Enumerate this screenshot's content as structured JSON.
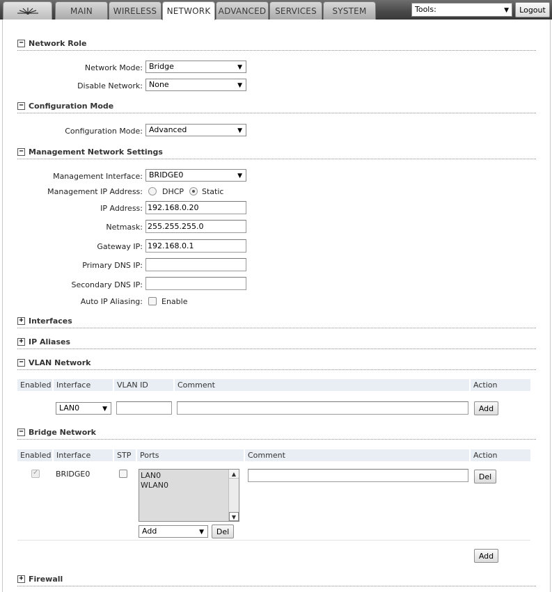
{
  "topbar": {
    "tabs": [
      {
        "label": "MAIN"
      },
      {
        "label": "WIRELESS"
      },
      {
        "label": "NETWORK"
      },
      {
        "label": "ADVANCED"
      },
      {
        "label": "SERVICES"
      },
      {
        "label": "SYSTEM"
      }
    ],
    "active_tab": "NETWORK",
    "tools_select": "Tools:",
    "logout_label": "Logout",
    "logo_icon": "ubiquiti-logo-icon"
  },
  "network_role": {
    "title": "Network Role",
    "network_mode_label": "Network Mode:",
    "network_mode_value": "Bridge",
    "disable_network_label": "Disable Network:",
    "disable_network_value": "None"
  },
  "configuration_mode": {
    "title": "Configuration Mode",
    "label": "Configuration Mode:",
    "value": "Advanced"
  },
  "management": {
    "title": "Management Network Settings",
    "interface_label": "Management Interface:",
    "interface_value": "BRIDGE0",
    "ip_address_mode_label": "Management IP Address:",
    "dhcp_label": "DHCP",
    "static_label": "Static",
    "ip_mode_selected": "Static",
    "ip_address_label": "IP Address:",
    "ip_address_value": "192.168.0.20",
    "netmask_label": "Netmask:",
    "netmask_value": "255.255.255.0",
    "gateway_label": "Gateway IP:",
    "gateway_value": "192.168.0.1",
    "primary_dns_label": "Primary DNS IP:",
    "primary_dns_value": "",
    "secondary_dns_label": "Secondary DNS IP:",
    "secondary_dns_value": "",
    "auto_ip_aliasing_label": "Auto IP Aliasing:",
    "auto_ip_aliasing_option": "Enable"
  },
  "interfaces": {
    "title": "Interfaces"
  },
  "ip_aliases": {
    "title": "IP Aliases"
  },
  "vlan": {
    "title": "VLAN Network",
    "columns": [
      "Enabled",
      "Interface",
      "VLAN ID",
      "Comment",
      "Action"
    ],
    "new_row": {
      "interface_value": "LAN0",
      "vlan_id_value": "",
      "comment_value": "",
      "action_label": "Add"
    }
  },
  "bridge": {
    "title": "Bridge Network",
    "columns": [
      "Enabled",
      "Interface",
      "STP",
      "Ports",
      "Comment",
      "Action"
    ],
    "rows": [
      {
        "enabled": true,
        "interface": "BRIDGE0",
        "stp": false,
        "ports": [
          "LAN0",
          "WLAN0"
        ],
        "port_select_value": "Add",
        "port_del_label": "Del",
        "comment": "",
        "action_label": "Del"
      }
    ],
    "add_label": "Add"
  },
  "firewall": {
    "title": "Firewall"
  }
}
